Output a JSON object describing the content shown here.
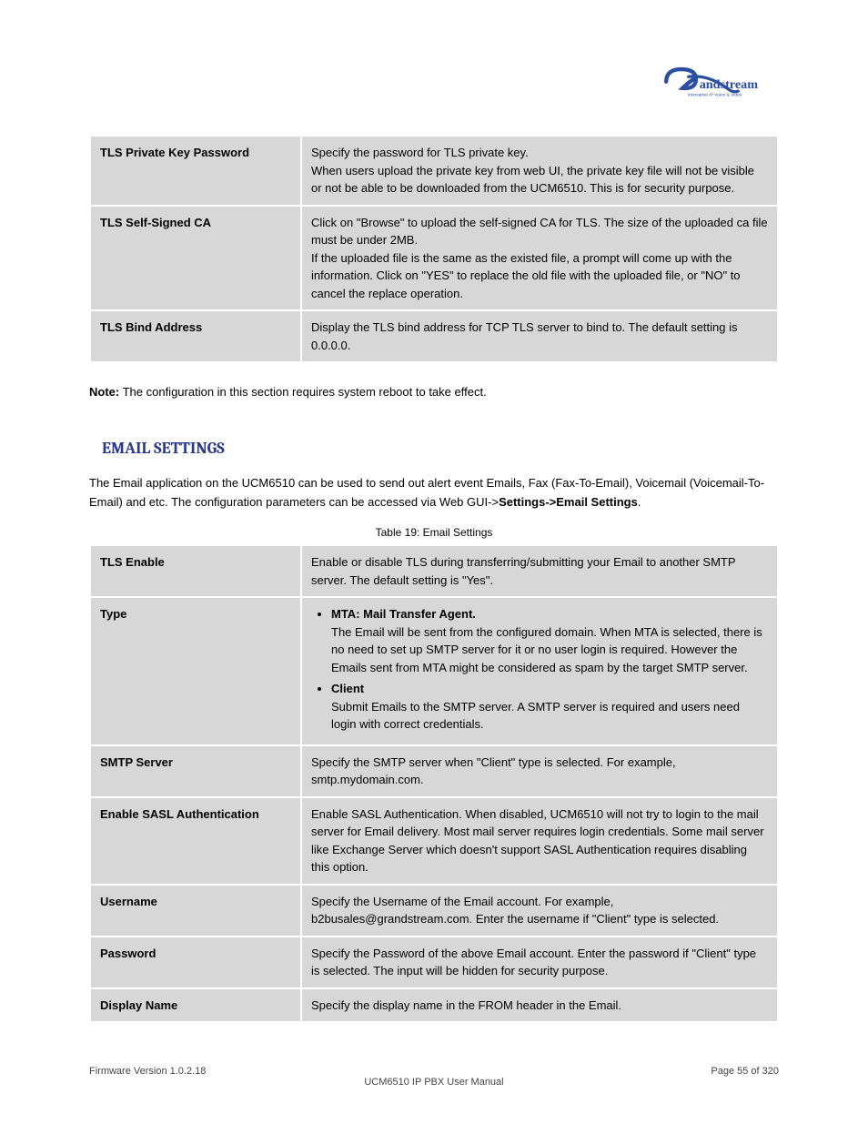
{
  "logo": {
    "brand": "Grandstream",
    "tagline": "Innovative IP Voice & Video"
  },
  "tables": {
    "tls": {
      "rows": [
        {
          "label": "TLS Private Key Password",
          "desc_lines": [
            "Specify the password for TLS private key.",
            "When users upload the private key from web UI, the private key file will not be visible or not be able to be downloaded from the UCM6510. This is for security purpose."
          ]
        },
        {
          "label": "TLS Self-Signed CA",
          "desc_lines": [
            "Click on \"Browse\" to upload the self-signed CA for TLS. The size of the uploaded ca file must be under 2MB.",
            "If the uploaded file is the same as the existed file, a prompt will come up with the information. Click on \"YES\" to replace the old file with the uploaded file, or \"NO\" to cancel the replace operation."
          ]
        },
        {
          "label": "TLS Bind Address",
          "desc_lines": [
            "Display the TLS bind address for TCP TLS server to bind to. The default setting is 0.0.0.0."
          ]
        }
      ]
    },
    "email": {
      "caption": "Table 19: Email Settings",
      "rows": [
        {
          "label": "TLS Enable",
          "desc": "Enable or disable TLS during transferring/submitting your Email to another SMTP server. The default setting is \"Yes\"."
        },
        {
          "label": "Type",
          "bullets": [
            {
              "head": "MTA: Mail Transfer Agent.",
              "body": "The Email will be sent from the configured domain. When MTA is selected, there is no need to set up SMTP server for it or no user login is required. However the Emails sent from MTA might be considered as spam by the target SMTP server."
            },
            {
              "head": "Client",
              "body": "Submit Emails to the SMTP server. A SMTP server is required and users need login with correct credentials."
            }
          ]
        },
        {
          "label": "SMTP Server",
          "desc": "Specify the SMTP server when \"Client\" type is selected. For example, smtp.mydomain.com."
        },
        {
          "label": "Enable SASL Authentication",
          "desc": "Enable SASL Authentication. When disabled, UCM6510 will not try to login to the mail server for Email delivery. Most mail server requires login credentials. Some mail server like Exchange Server which doesn't support SASL Authentication requires disabling this option."
        },
        {
          "label": "Username",
          "desc": "Specify the Username of the Email account. For example, b2busales@grandstream.com. Enter the username if \"Client\" type is selected."
        },
        {
          "label": "Password",
          "desc": "Specify the Password of the above Email account. Enter the password if \"Client\" type is selected. The input will be hidden for security purpose."
        },
        {
          "label": "Display Name",
          "desc": "Specify the display name in the FROM header in the Email."
        }
      ]
    }
  },
  "note": {
    "label": "Note:",
    "body": " The configuration in this section requires system reboot to take effect."
  },
  "email_section": {
    "heading": "EMAIL SETTINGS",
    "paragraph_pre": "The Email application on the UCM6510 can be used to send out alert event Emails, Fax (Fax-To-Email), Voicemail (Voicemail-To-Email) and etc. The configuration parameters can be accessed via Web GUI->",
    "paragraph_bold": "Settings->Email Settings",
    "paragraph_post": "."
  },
  "footer": {
    "left": "Firmware Version 1.0.2.18",
    "center": "UCM6510 IP PBX User Manual",
    "right": "Page 55 of 320"
  }
}
